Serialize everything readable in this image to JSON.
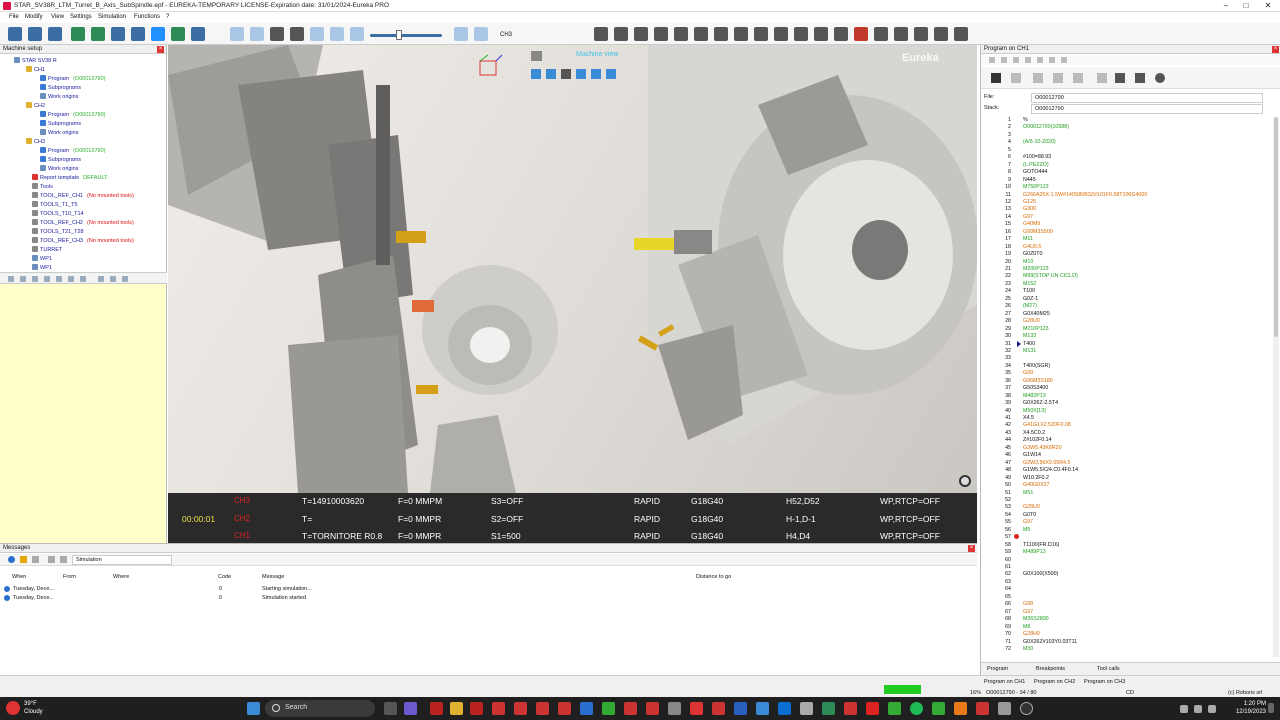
{
  "window": {
    "title": "STAR_SV38R_LTM_Turret_B_Axis_SubSpindle.epf - EUREKA-TEMPORARY LICENSE-Expiration date: 31/01/2024-Eureka PRO",
    "minimize": "–",
    "maximize": "□",
    "close": "✕"
  },
  "menu": [
    "File",
    "Modify",
    "View",
    "Settings",
    "Simulation",
    "Functions",
    "?"
  ],
  "toolbar": {
    "channel": "CH3"
  },
  "machine_setup": {
    "title": "Machine setup",
    "tree": [
      {
        "label": "STAR SV38 R",
        "extra": ""
      },
      {
        "label": "CH1",
        "extra": ""
      },
      {
        "label": "Program",
        "extra": "(O00012790)"
      },
      {
        "label": "Subprograms",
        "extra": ""
      },
      {
        "label": "Work origins",
        "extra": ""
      },
      {
        "label": "CH2",
        "extra": ""
      },
      {
        "label": "Program",
        "extra": "(O00012790)"
      },
      {
        "label": "Subprograms",
        "extra": ""
      },
      {
        "label": "Work origins",
        "extra": ""
      },
      {
        "label": "CH3",
        "extra": ""
      },
      {
        "label": "Program",
        "extra": "(O00012790)"
      },
      {
        "label": "Subprograms",
        "extra": ""
      },
      {
        "label": "Work origins",
        "extra": ""
      },
      {
        "label": "Report template",
        "extra": "DEFAULT"
      },
      {
        "label": "Tools",
        "extra": ""
      },
      {
        "label": "TOOL_REF_CH1",
        "extra": "(No mounted tools)"
      },
      {
        "label": "TOOLS_T1_T5",
        "extra": ""
      },
      {
        "label": "TOOLS_T10_T14",
        "extra": ""
      },
      {
        "label": "TOOL_REF_CH2",
        "extra": "(No mounted tools)"
      },
      {
        "label": "TOOLS_T21_T28",
        "extra": ""
      },
      {
        "label": "TOOL_REF_CH3",
        "extra": "(No mounted tools)"
      },
      {
        "label": "TURRET",
        "extra": ""
      },
      {
        "label": "WP1",
        "extra": ""
      },
      {
        "label": "WP1",
        "extra": ""
      }
    ]
  },
  "viewport": {
    "label": "Machine view",
    "brand": "Eureka",
    "status": {
      "time": "00:00:01",
      "rows": [
        {
          "ch": "CH3",
          "t": "T=14910003620",
          "f": "F=0 MMPM",
          "s": "S3=OFF",
          "mode": "RAPID",
          "g": "G18G40",
          "h": "H52,D52",
          "wp": "WP,RTCP=OFF"
        },
        {
          "ch": "CH2",
          "t": "T=",
          "f": "F=0 MMPR",
          "s": "S2=OFF",
          "mode": "RAPID",
          "g": "G18G40",
          "h": "H-1,D-1",
          "wp": "WP,RTCP=OFF"
        },
        {
          "ch": "CH1",
          "t": "T=TORNITORE R0.8",
          "f": "F=0 MMPR",
          "s": "S1=500",
          "mode": "RAPID",
          "g": "G18G40",
          "h": "H4,D4",
          "wp": "WP,RTCP=OFF"
        }
      ]
    }
  },
  "messages": {
    "title": "Messages",
    "filter": "Simulation",
    "columns": {
      "when": "When",
      "from": "From",
      "where": "Where",
      "code": "Code",
      "message": "Message",
      "distance": "Distance to go"
    },
    "rows": [
      {
        "when": "Tuesday, Dece...",
        "code": "0",
        "message": "Starting simulation..."
      },
      {
        "when": "Tuesday, Dece...",
        "code": "0",
        "message": "Simulation started"
      }
    ]
  },
  "program": {
    "title": "Program on CH1",
    "file_label": "File:",
    "file_value": "O00012790",
    "stack_label": "Stack:",
    "stack_value": "O00012790",
    "lines": [
      {
        "n": "1",
        "c": "%"
      },
      {
        "n": "2",
        "c": "O00012790(10588)"
      },
      {
        "n": "3",
        "c": ""
      },
      {
        "n": "4",
        "c": "(A/5-10-2020)"
      },
      {
        "n": "5",
        "c": ""
      },
      {
        "n": "6",
        "c": "#100=88.93"
      },
      {
        "n": "7",
        "c": "(L.PEZZO)"
      },
      {
        "n": "8",
        "c": "GOTO444"
      },
      {
        "n": "9",
        "c": "N445"
      },
      {
        "n": "10",
        "c": "M750P123"
      },
      {
        "n": "11",
        "c": "G266A25X-1.5W#140S80B3Z#101F0.08T100G4000"
      },
      {
        "n": "12",
        "c": "G125"
      },
      {
        "n": "13",
        "c": "G300"
      },
      {
        "n": "14",
        "c": "G97"
      },
      {
        "n": "15",
        "c": "G40M9"
      },
      {
        "n": "16",
        "c": "G99M3S500"
      },
      {
        "n": "17",
        "c": "M11"
      },
      {
        "n": "18",
        "c": "G4U0.5"
      },
      {
        "n": "19",
        "c": "G0Z0T0"
      },
      {
        "n": "20",
        "c": "M10"
      },
      {
        "n": "21",
        "c": "M200P123"
      },
      {
        "n": "22",
        "c": "M99(STOP UN CICLO)"
      },
      {
        "n": "23",
        "c": "M152"
      },
      {
        "n": "24",
        "c": "T100"
      },
      {
        "n": "25",
        "c": "G0Z-1"
      },
      {
        "n": "26",
        "c": "(M27)"
      },
      {
        "n": "27",
        "c": "G0X40M25"
      },
      {
        "n": "28",
        "c": "G28U0"
      },
      {
        "n": "29",
        "c": "M210P123"
      },
      {
        "n": "30",
        "c": "M133"
      },
      {
        "n": "31",
        "c": "T400"
      },
      {
        "n": "32",
        "c": "M131"
      },
      {
        "n": "33",
        "c": ""
      },
      {
        "n": "34",
        "c": "T400(SGR)"
      },
      {
        "n": "35",
        "c": "G99"
      },
      {
        "n": "36",
        "c": "G96M3S180"
      },
      {
        "n": "37",
        "c": "G50S3400"
      },
      {
        "n": "38",
        "c": "M482P13"
      },
      {
        "n": "39",
        "c": "G0X26Z-2.5T4"
      },
      {
        "n": "40",
        "c": "M50X[13]"
      },
      {
        "n": "41",
        "c": "X4.5"
      },
      {
        "n": "42",
        "c": "G41G1X2.5Z0F0.08"
      },
      {
        "n": "43",
        "c": "X4.5C0.2"
      },
      {
        "n": "44",
        "c": "Z#102F0.14"
      },
      {
        "n": "45",
        "c": "G3W5.43K6R20"
      },
      {
        "n": "46",
        "c": "G1W14"
      },
      {
        "n": "47",
        "c": "G3W3.56X9.55R4.5"
      },
      {
        "n": "48",
        "c": "G1W5.5X24.C0.4F0.14"
      },
      {
        "n": "49",
        "c": "W10.2F0.2"
      },
      {
        "n": "50",
        "c": "G40G0X27"
      },
      {
        "n": "51",
        "c": "M51"
      },
      {
        "n": "52",
        "c": ""
      },
      {
        "n": "53",
        "c": "G28U0"
      },
      {
        "n": "54",
        "c": "G0T0"
      },
      {
        "n": "55",
        "c": "G97"
      },
      {
        "n": "56",
        "c": "M5"
      },
      {
        "n": "57",
        "c": ""
      },
      {
        "n": "58",
        "c": "T1100(FR.D16)"
      },
      {
        "n": "59",
        "c": "M489P13"
      },
      {
        "n": "60",
        "c": ""
      },
      {
        "n": "61",
        "c": ""
      },
      {
        "n": "62",
        "c": "G0X100(X500)"
      },
      {
        "n": "63",
        "c": ""
      },
      {
        "n": "64",
        "c": ""
      },
      {
        "n": "65",
        "c": ""
      },
      {
        "n": "66",
        "c": "G98"
      },
      {
        "n": "67",
        "c": "G97"
      },
      {
        "n": "68",
        "c": "M36S2800"
      },
      {
        "n": "69",
        "c": "M8"
      },
      {
        "n": "70",
        "c": "G28H0"
      },
      {
        "n": "71",
        "c": "G0X26Z#103Y0.03T11"
      },
      {
        "n": "72",
        "c": "M30"
      }
    ],
    "tabs": [
      "Program",
      "Breakpoints",
      "Tool calls"
    ]
  },
  "status_bar": {
    "tabs": [
      "Program on CH1",
      "Program on CH2",
      "Program on CH3"
    ],
    "percent": "16%",
    "position": "O00012790 - 34 / 80",
    "cd": "CD",
    "copyright": "(c) Roboris srl"
  },
  "taskbar": {
    "temp": "39°F",
    "weather": "Cloudy",
    "search": "Search",
    "time": "1:20 PM",
    "date": "12/19/2023"
  }
}
